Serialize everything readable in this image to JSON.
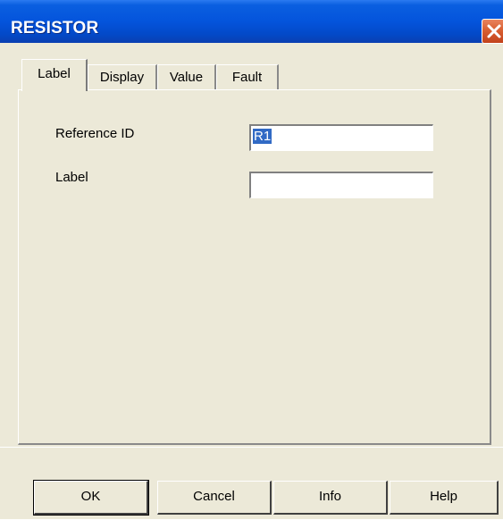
{
  "window": {
    "title": "RESISTOR"
  },
  "tabs": [
    {
      "label": "Label",
      "active": true
    },
    {
      "label": "Display",
      "active": false
    },
    {
      "label": "Value",
      "active": false
    },
    {
      "label": "Fault",
      "active": false
    }
  ],
  "form": {
    "reference_id_label": "Reference ID",
    "reference_id_value": "R1",
    "label_label": "Label",
    "label_value": ""
  },
  "buttons": {
    "ok": "OK",
    "cancel": "Cancel",
    "info": "Info",
    "help": "Help"
  },
  "colors": {
    "title_bar": "#0454dc",
    "dialog_background": "#ece9d8",
    "close_button": "#d95f31",
    "selection": "#316ac5"
  }
}
